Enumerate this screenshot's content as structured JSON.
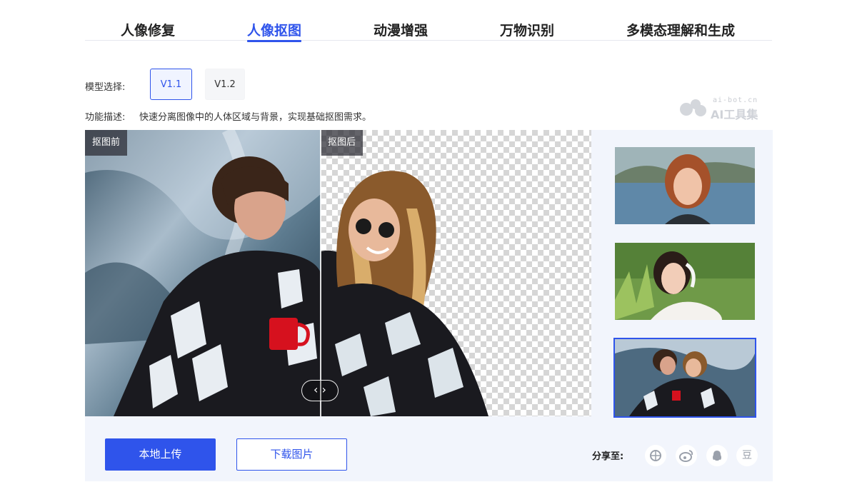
{
  "tabs": [
    {
      "label": "人像修复",
      "active": false
    },
    {
      "label": "人像抠图",
      "active": true
    },
    {
      "label": "动漫增强",
      "active": false
    },
    {
      "label": "万物识别",
      "active": false
    },
    {
      "label": "多模态理解和生成",
      "active": false
    }
  ],
  "model": {
    "label": "模型选择:",
    "options": [
      "V1.1",
      "V1.2"
    ],
    "selected": "V1.1"
  },
  "description": {
    "label": "功能描述:",
    "text": "快速分离图像中的人体区域与背景，实现基础抠图需求。"
  },
  "watermark": {
    "url": "ai-bot.cn",
    "brand": "AI工具集"
  },
  "stage": {
    "before_tag": "抠图前",
    "after_tag": "抠图后",
    "handle_icon": "left-right-arrows-icon"
  },
  "thumbnails": [
    {
      "name": "red-haired-woman-lake",
      "selected": false
    },
    {
      "name": "woman-headphones-field",
      "selected": false
    },
    {
      "name": "two-women-blankets",
      "selected": true
    }
  ],
  "actions": {
    "upload_label": "本地上传",
    "download_label": "下载图片"
  },
  "share": {
    "label": "分享至:",
    "icons": [
      "moments-icon",
      "weibo-icon",
      "qq-icon",
      "douban-icon"
    ],
    "douban_glyph": "豆"
  },
  "colors": {
    "accent": "#2f54eb",
    "panel_bg": "#f2f5fc"
  }
}
